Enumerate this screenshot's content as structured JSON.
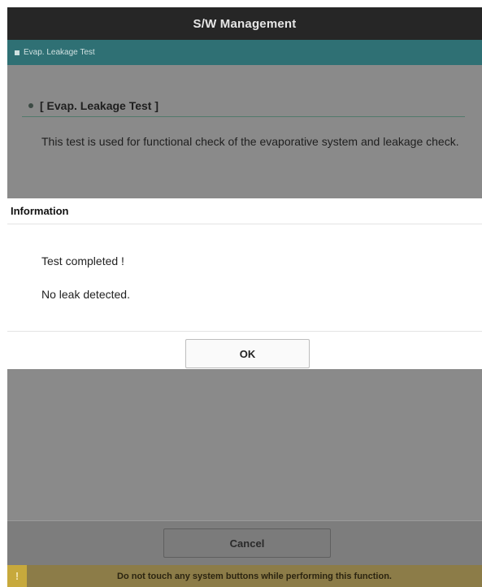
{
  "window": {
    "title": "S/W Management"
  },
  "breadcrumb": {
    "label": "Evap. Leakage Test"
  },
  "section": {
    "title": "[ Evap. Leakage Test ]",
    "description": "This test is used for functional check of the evaporative system and leakage check."
  },
  "dialog": {
    "title": "Information",
    "message_line1": "Test completed !",
    "message_line2": "No leak detected.",
    "ok_label": "OK"
  },
  "footer": {
    "cancel_label": "Cancel"
  },
  "warning": {
    "badge": "!",
    "text": "Do not touch any system buttons while performing this function."
  },
  "colors": {
    "title_bar": "#262626",
    "sub_bar": "#2f7074",
    "overlay": "#8a8a8a",
    "warning_badge": "#c7a93c"
  }
}
